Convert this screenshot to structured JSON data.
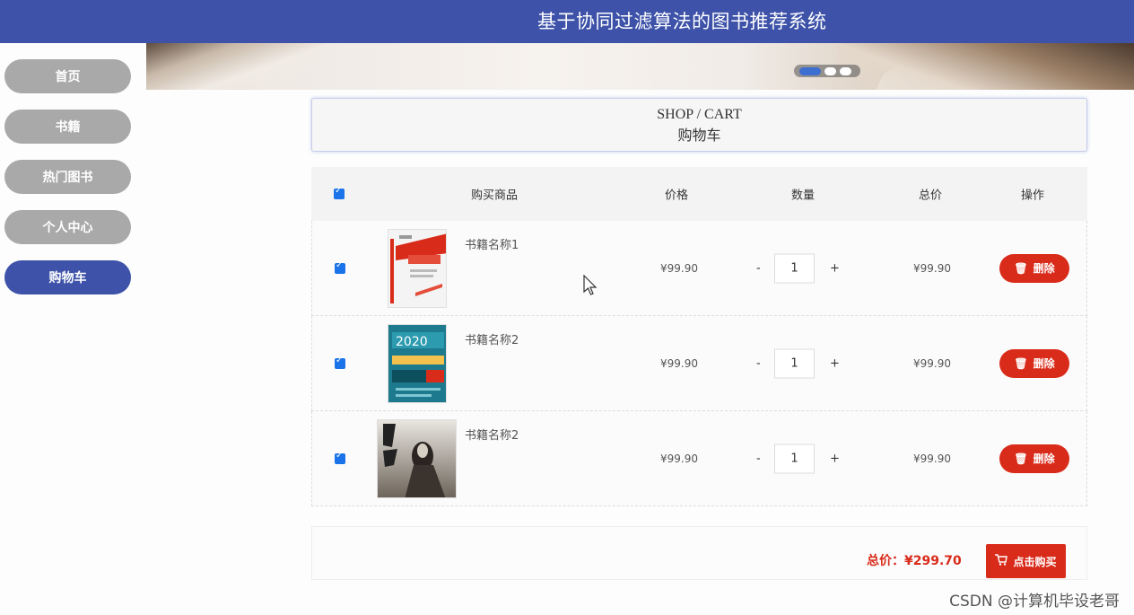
{
  "header": {
    "title": "基于协同过滤算法的图书推荐系统"
  },
  "sidebar": {
    "items": [
      {
        "label": "首页",
        "active": false
      },
      {
        "label": "书籍",
        "active": false
      },
      {
        "label": "热门图书",
        "active": false
      },
      {
        "label": "个人中心",
        "active": false
      },
      {
        "label": "购物车",
        "active": true
      }
    ]
  },
  "cart_header": {
    "en": "SHOP / CART",
    "cn": "购物车"
  },
  "table": {
    "columns": {
      "product": "购买商品",
      "price": "价格",
      "quantity": "数量",
      "total": "总价",
      "action": "操作"
    },
    "rows": [
      {
        "name": "书籍名称1",
        "price": "¥99.90",
        "minus": "-",
        "qty": "1",
        "plus": "+",
        "total": "¥99.90",
        "delete_label": "删除",
        "checked": true
      },
      {
        "name": "书籍名称2",
        "price": "¥99.90",
        "minus": "-",
        "qty": "1",
        "plus": "+",
        "total": "¥99.90",
        "delete_label": "删除",
        "checked": true
      },
      {
        "name": "书籍名称2",
        "price": "¥99.90",
        "minus": "-",
        "qty": "1",
        "plus": "+",
        "total": "¥99.90",
        "delete_label": "删除",
        "checked": true
      }
    ]
  },
  "footer": {
    "total_label": "总价：¥299.70",
    "buy_label": "点击购买"
  },
  "watermark": "CSDN @计算机毕设老哥",
  "colors": {
    "primary": "#3d52a8",
    "danger": "#d92b1a",
    "inactive": "#a9a9a9"
  }
}
